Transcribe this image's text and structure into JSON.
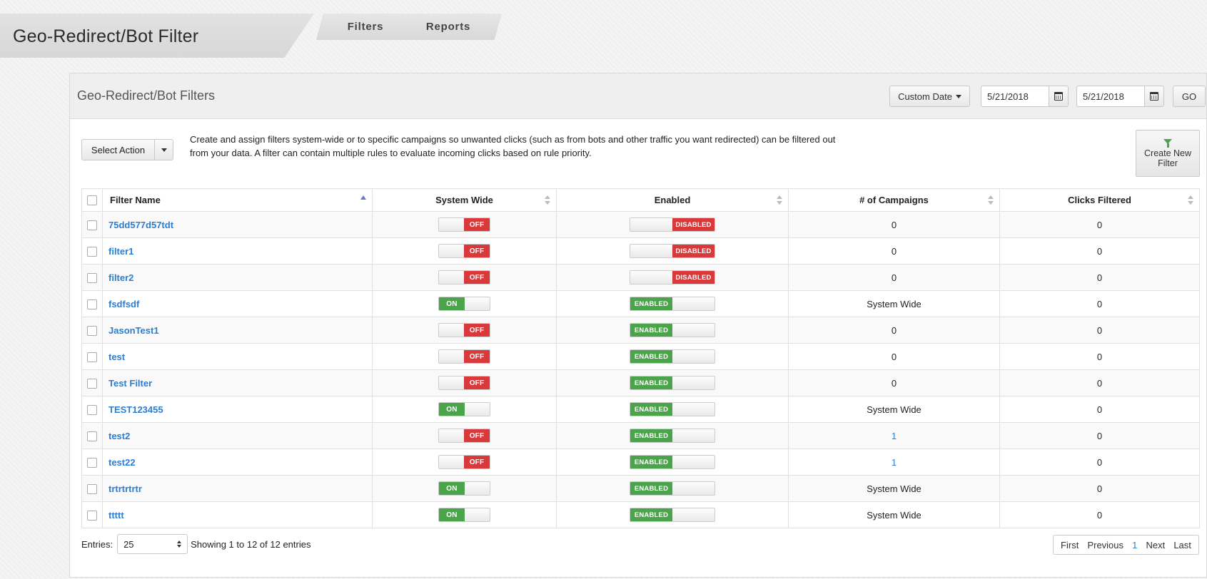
{
  "header": {
    "title": "Geo-Redirect/Bot Filter",
    "tabs": [
      {
        "label": "Filters"
      },
      {
        "label": "Reports"
      }
    ]
  },
  "panel": {
    "title": "Geo-Redirect/Bot Filters",
    "date_range_label": "Custom Date",
    "start_date": "5/21/2018",
    "end_date": "5/21/2018",
    "go_label": "GO",
    "select_action_label": "Select Action",
    "description": "Create and assign filters system-wide or to specific campaigns so unwanted clicks (such as from bots and other traffic you want redirected) can be filtered out from your data. A filter can contain multiple rules to evaluate incoming clicks based on rule priority.",
    "create_button_label": "Create New Filter"
  },
  "table": {
    "columns": [
      "Filter Name",
      "System Wide",
      "Enabled",
      "# of Campaigns",
      "Clicks Filtered"
    ],
    "rows": [
      {
        "name": "75dd577d57tdt",
        "system_wide": "OFF",
        "enabled": "DISABLED",
        "campaigns": "0",
        "clicks": "0"
      },
      {
        "name": "filter1",
        "system_wide": "OFF",
        "enabled": "DISABLED",
        "campaigns": "0",
        "clicks": "0"
      },
      {
        "name": "filter2",
        "system_wide": "OFF",
        "enabled": "DISABLED",
        "campaigns": "0",
        "clicks": "0"
      },
      {
        "name": "fsdfsdf",
        "system_wide": "ON",
        "enabled": "ENABLED",
        "campaigns": "System Wide",
        "clicks": "0"
      },
      {
        "name": "JasonTest1",
        "system_wide": "OFF",
        "enabled": "ENABLED",
        "campaigns": "0",
        "clicks": "0"
      },
      {
        "name": "test",
        "system_wide": "OFF",
        "enabled": "ENABLED",
        "campaigns": "0",
        "clicks": "0"
      },
      {
        "name": "Test Filter",
        "system_wide": "OFF",
        "enabled": "ENABLED",
        "campaigns": "0",
        "clicks": "0"
      },
      {
        "name": "TEST123455",
        "system_wide": "ON",
        "enabled": "ENABLED",
        "campaigns": "System Wide",
        "clicks": "0"
      },
      {
        "name": "test2",
        "system_wide": "OFF",
        "enabled": "ENABLED",
        "campaigns": "1",
        "clicks": "0"
      },
      {
        "name": "test22",
        "system_wide": "OFF",
        "enabled": "ENABLED",
        "campaigns": "1",
        "clicks": "0"
      },
      {
        "name": "trtrtrtrtr",
        "system_wide": "ON",
        "enabled": "ENABLED",
        "campaigns": "System Wide",
        "clicks": "0"
      },
      {
        "name": "ttttt",
        "system_wide": "ON",
        "enabled": "ENABLED",
        "campaigns": "System Wide",
        "clicks": "0"
      }
    ]
  },
  "footer": {
    "entries_label": "Entries:",
    "entries_value": "25",
    "showing_text": "Showing 1 to 12 of 12 entries",
    "pager": {
      "first": "First",
      "previous": "Previous",
      "current": "1",
      "next": "Next",
      "last": "Last"
    }
  },
  "colors": {
    "link": "#2a7ed3",
    "on": "#4aa54a",
    "off": "#d9393a"
  }
}
